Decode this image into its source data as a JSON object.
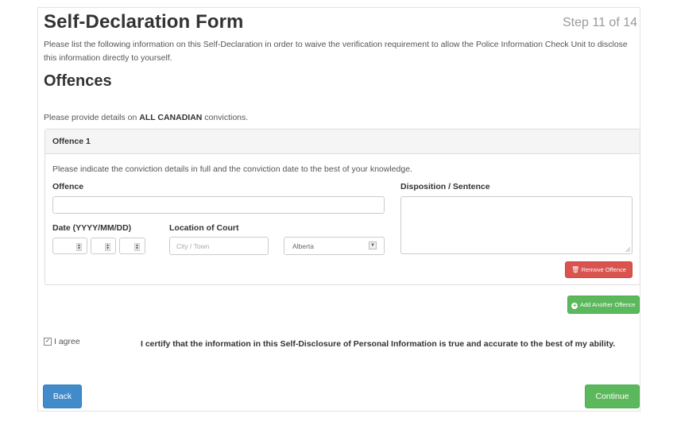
{
  "header": {
    "title": "Self-Declaration Form",
    "step": "Step 11 of 14",
    "intro": "Please list the following information on this Self-Declaration in order to waive the verification requirement to allow the Police Information Check Unit to disclose this information directly to yourself."
  },
  "section": {
    "title": "Offences",
    "subtitle_prefix": "Please provide details on ",
    "subtitle_bold": "ALL CANADIAN",
    "subtitle_suffix": " convictions."
  },
  "offence_panel": {
    "heading": "Offence 1",
    "hint": "Please indicate the conviction details in full and the conviction date to the best of your knowledge.",
    "offence_label": "Offence",
    "offence_value": "",
    "date_label": "Date (YYYY/MM/DD)",
    "date_year": "",
    "date_month": "",
    "date_day": "",
    "location_label": "Location of Court",
    "city_placeholder": "City / Town",
    "province_selected": "Alberta",
    "disposition_label": "Disposition / Sentence",
    "disposition_value": "",
    "remove_button": "Remove Offence",
    "remove_icon": "trash-icon"
  },
  "add_button": {
    "label": "Add Another Offence",
    "icon": "plus-circle-icon"
  },
  "agreement": {
    "checkbox_label": "I agree",
    "checked": true,
    "certify_text": "I certify that the information in this Self-Disclosure of Personal Information is true and accurate to the best of my ability."
  },
  "footer": {
    "back": "Back",
    "continue": "Continue"
  },
  "colors": {
    "danger": "#d9534f",
    "success": "#5cb85c",
    "primary": "#428bca"
  }
}
